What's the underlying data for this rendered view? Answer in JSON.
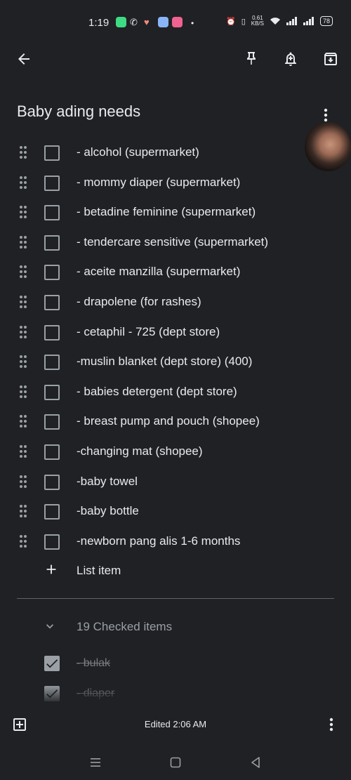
{
  "status_bar": {
    "time": "1:19",
    "net_speed_value": "0.61",
    "net_speed_unit": "KB/S",
    "battery": "78"
  },
  "note": {
    "title": "Baby ading needs"
  },
  "items": [
    {
      "text": "- alcohol (supermarket)"
    },
    {
      "text": "- mommy diaper (supermarket)"
    },
    {
      "text": "- betadine feminine (supermarket)"
    },
    {
      "text": "- tendercare sensitive (supermarket)"
    },
    {
      "text": "- aceite manzilla (supermarket)"
    },
    {
      "text": "- drapolene (for rashes)"
    },
    {
      "text": "- cetaphil - 725 (dept store)"
    },
    {
      "text": "-muslin blanket (dept store) (400)"
    },
    {
      "text": "- babies detergent (dept store)"
    },
    {
      "text": "- breast pump and pouch (shopee)"
    },
    {
      "text": "-changing mat (shopee)"
    },
    {
      "text": "-baby towel"
    },
    {
      "text": "-baby bottle"
    },
    {
      "text": "-newborn pang alis 1-6 months"
    }
  ],
  "add_item_label": "List item",
  "checked": {
    "header": "19 Checked items",
    "items": [
      {
        "text": "- bulak"
      },
      {
        "text": "- diaper"
      }
    ]
  },
  "footer": {
    "edited": "Edited 2:06 AM"
  },
  "colors": {
    "background": "#202124",
    "text": "#e8eaed",
    "muted": "#9aa0a6"
  }
}
